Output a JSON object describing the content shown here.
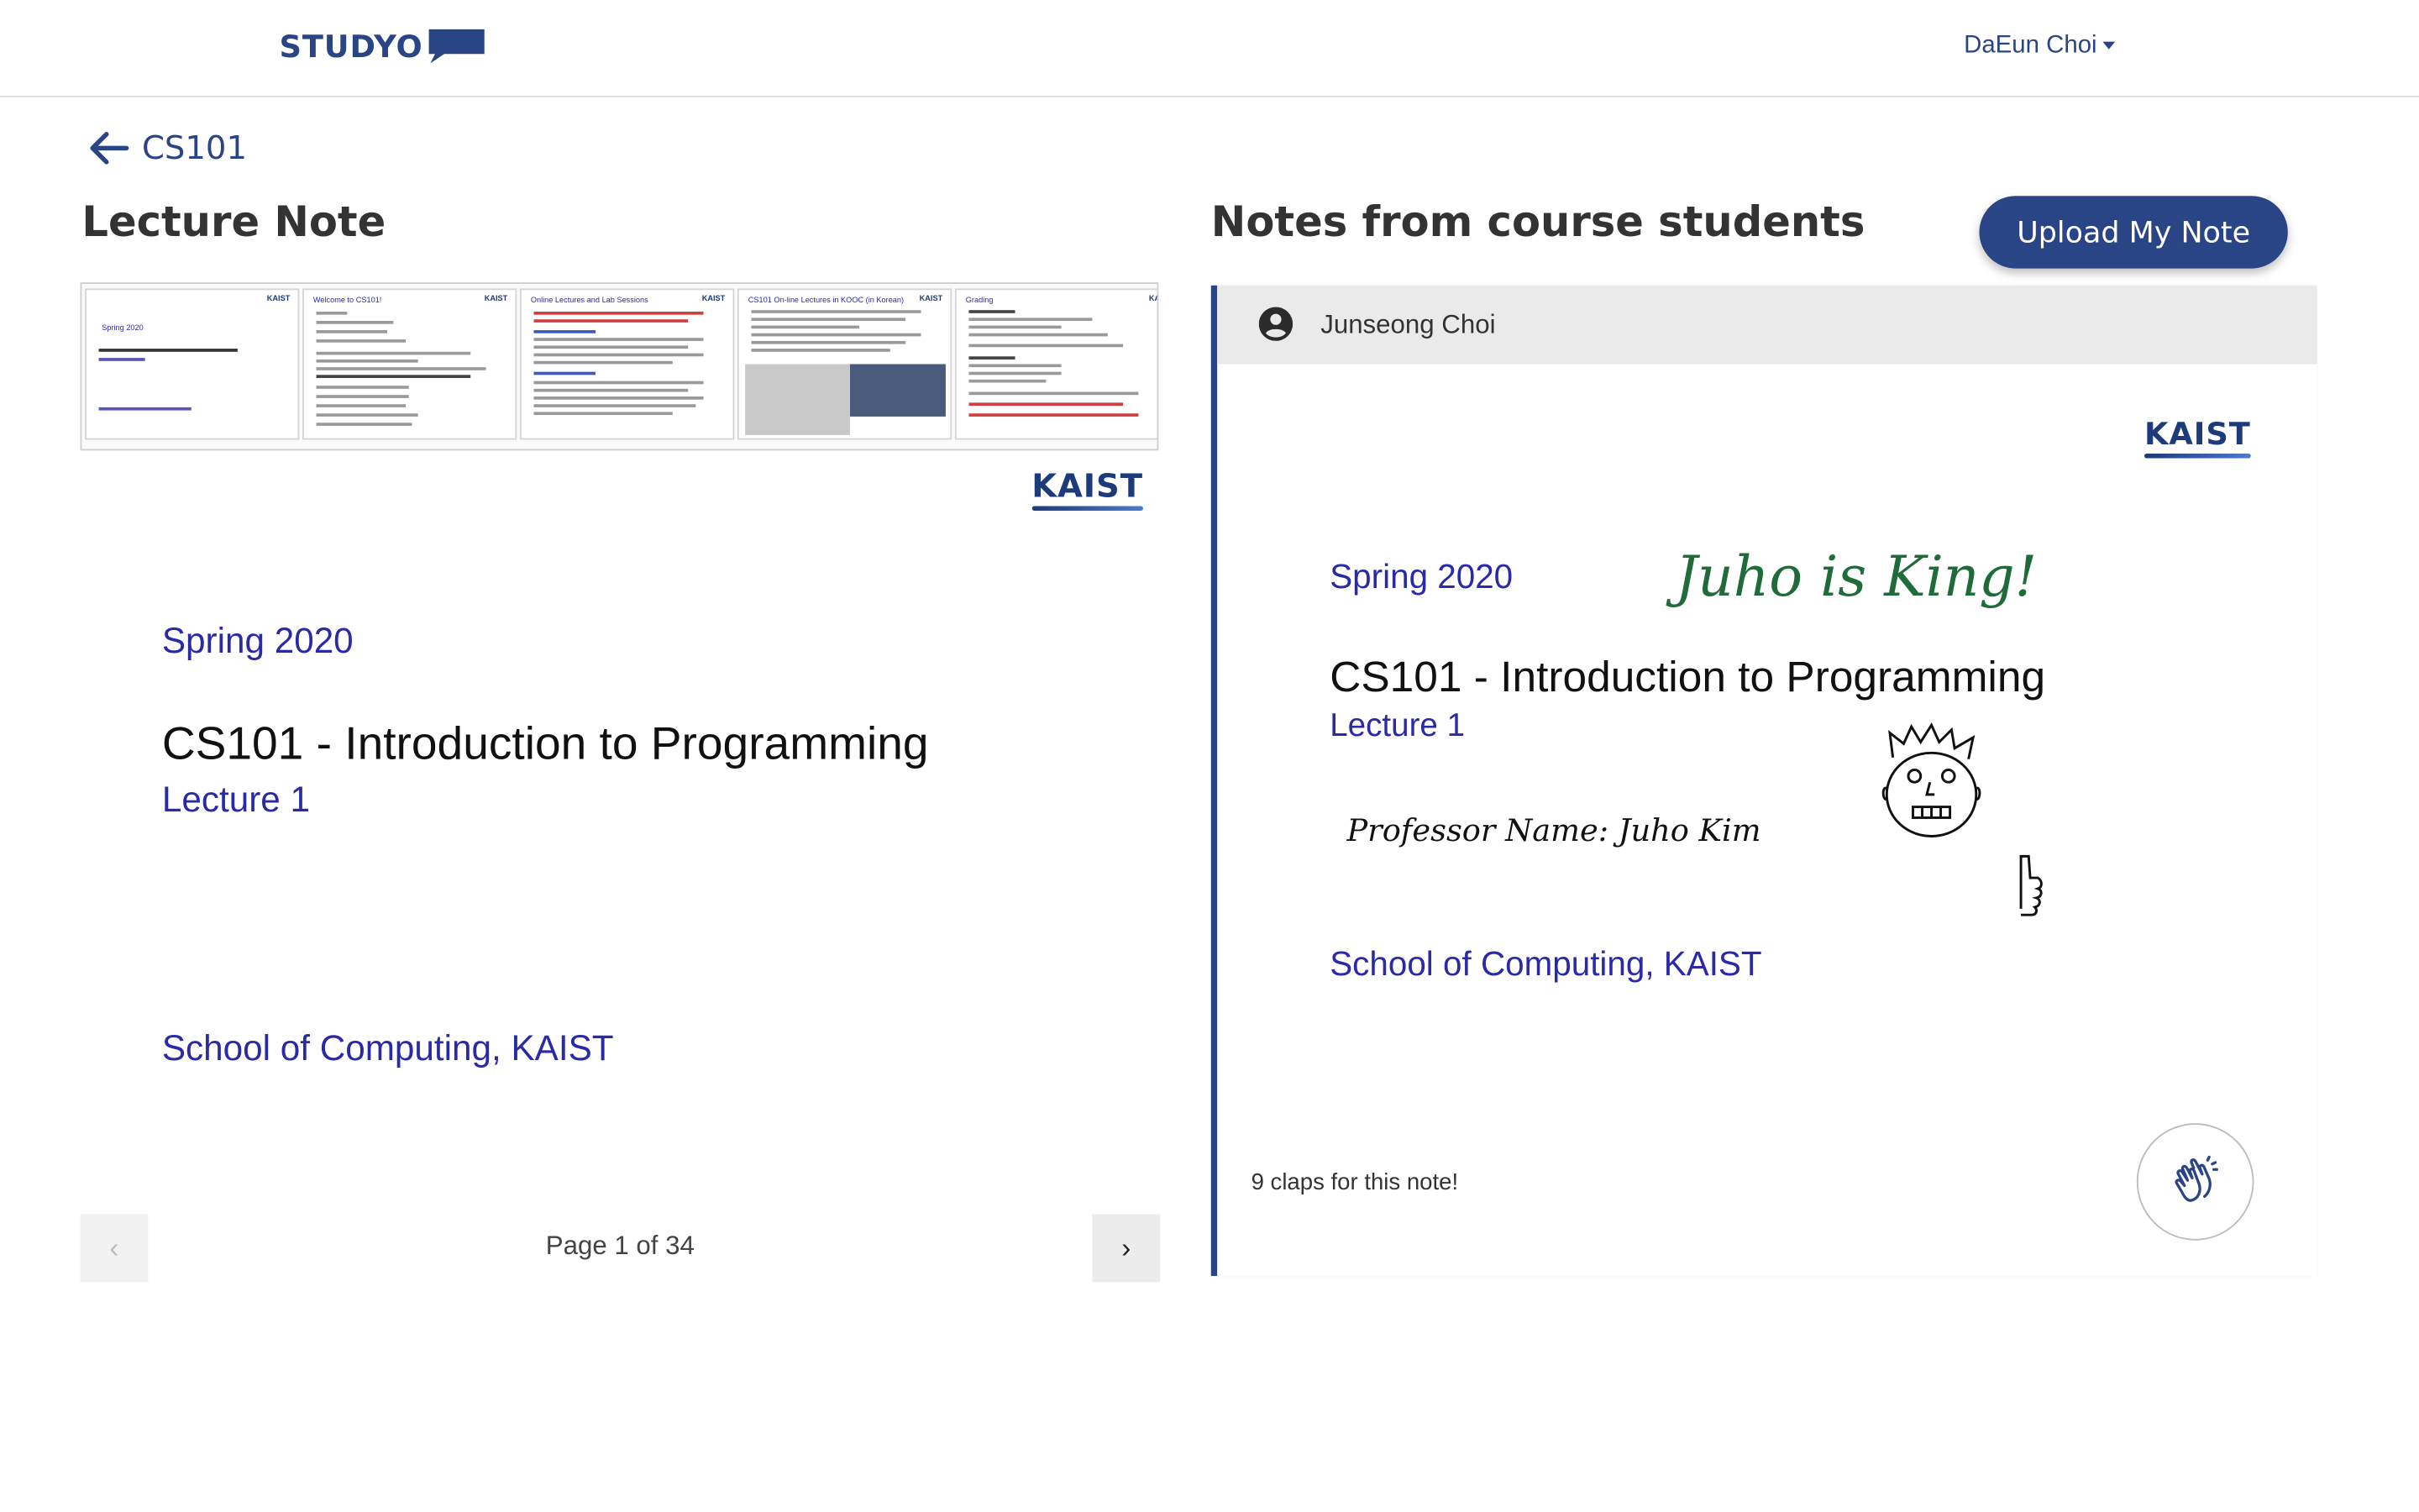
{
  "header": {
    "logo_text": "STUDYO",
    "user_name": "DaEun Choi"
  },
  "breadcrumb": {
    "back_label": "CS101"
  },
  "lecture_note": {
    "title": "Lecture Note",
    "thumbnails": [
      {
        "title": "Spring 2020",
        "kaist": "KAIST"
      },
      {
        "title": "Welcome to CS101!",
        "kaist": "KAIST"
      },
      {
        "title": "Online Lectures and Lab Sessions",
        "kaist": "KAIST"
      },
      {
        "title": "CS101 On-line Lectures in KOOC (in Korean)",
        "kaist": "KAIST"
      },
      {
        "title": "Grading",
        "kaist": "KA"
      }
    ],
    "slide": {
      "kaist": "KAIST",
      "term": "Spring 2020",
      "course": "CS101 - Introduction to Programming",
      "lecture": "Lecture 1",
      "school": "School of Computing, KAIST"
    },
    "pagination": {
      "prev_symbol": "‹",
      "next_symbol": "›",
      "indicator": "Page 1 of 34"
    }
  },
  "student_notes": {
    "title": "Notes from course students",
    "upload_label": "Upload My Note",
    "note": {
      "author": "Junseong Choi",
      "kaist": "KAIST",
      "term": "Spring 2020",
      "course": "CS101 - Introduction to Programming",
      "lecture": "Lecture 1",
      "school": "School of Computing, KAIST",
      "handwritten_title": "Juho is King!",
      "handwritten_professor": "Professor Name: Juho Kim",
      "claps_text": "9 claps for this note!"
    }
  },
  "colors": {
    "brand": "#2a4585",
    "slide_blue": "#2a2aa8",
    "handwriting_green": "#1f6b3a"
  },
  "icons": {
    "back": "arrow-left-icon",
    "user": "user-circle-icon",
    "clap": "clapping-hands-icon",
    "logo": "speech-bubble-icon"
  }
}
